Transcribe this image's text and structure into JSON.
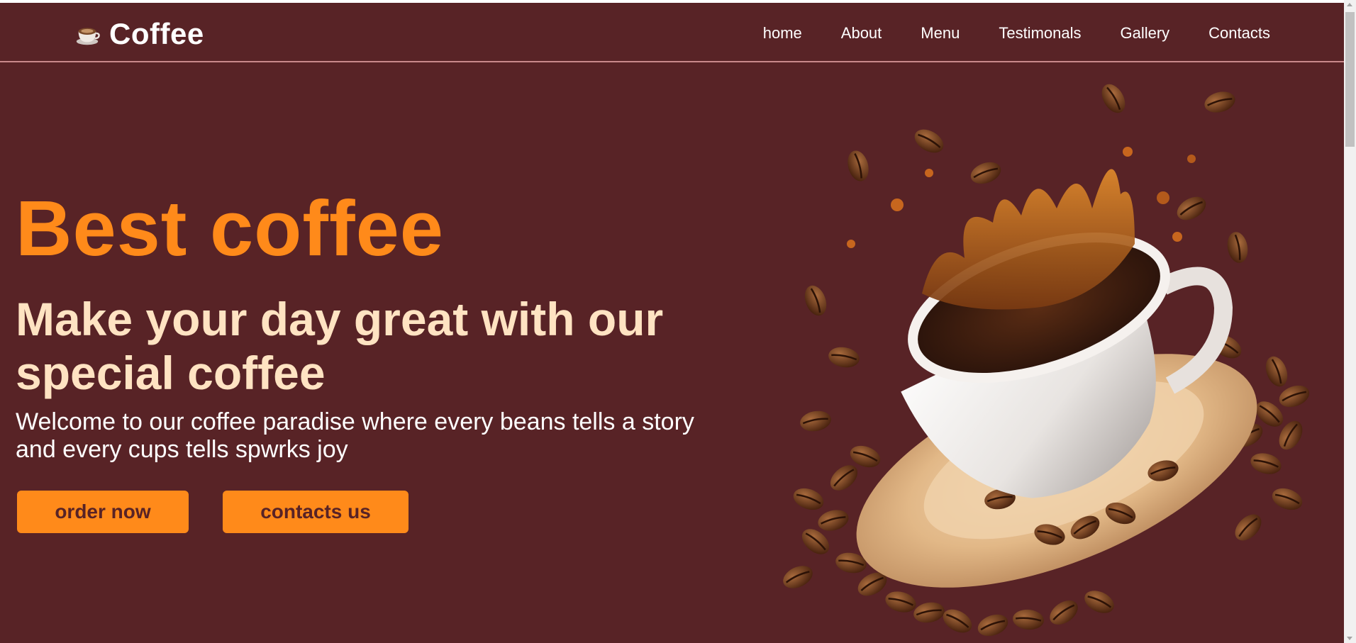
{
  "brand": {
    "name": "Coffee",
    "icon": "coffee-cup-icon"
  },
  "nav": {
    "items": [
      {
        "label": "home"
      },
      {
        "label": "About"
      },
      {
        "label": "Menu"
      },
      {
        "label": "Testimonals"
      },
      {
        "label": "Gallery"
      },
      {
        "label": "Contacts"
      }
    ]
  },
  "hero": {
    "title": "Best coffee",
    "subtitle": "Make your day great with our special coffee",
    "description": "Welcome to our coffee paradise where every beans tells a story and every cups tells spwrks joy",
    "buttons": {
      "order": "order now",
      "contact": "contacts us"
    },
    "image_icon": "coffee-cup-splash-image"
  },
  "colors": {
    "background": "#582326",
    "accent": "#ff8a1a",
    "subtitle": "#ffe3c2",
    "text": "#ffffff"
  }
}
